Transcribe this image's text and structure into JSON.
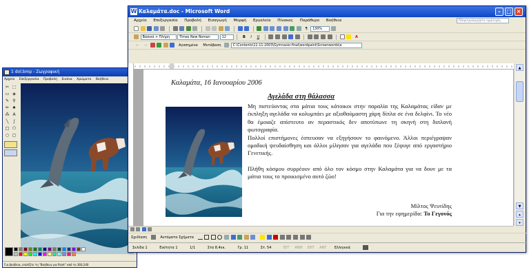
{
  "paint": {
    "title": "1 dol.bmp - Ζωγραφική",
    "menu": [
      "Αρχείο",
      "Επεξεργασία",
      "Προβολή",
      "Εικόνα",
      "Χρώματα",
      "Βοήθεια"
    ],
    "status": "Για βοήθεια, επιλέξτε τη \"Βοήθεια για Paint\" από το 360,240"
  },
  "word": {
    "title": "Καλαμάτα.doc - Microsoft Word",
    "menu": [
      "Αρχείο",
      "Επεξεργασία",
      "Προβολή",
      "Εισαγωγή",
      "Μορφή",
      "Εργαλεία",
      "Πίνακας",
      "Παράθυρο",
      "Βοήθεια"
    ],
    "help_placeholder": "Πληκτρολογήστε ερώτηση",
    "zoom": "130%",
    "style": "Βασικό + Πλήρη",
    "font": "Times New Roman",
    "size": "12",
    "web_back": "Αγαπημένα",
    "web_go": "Μετάβαση",
    "address": "C:\\Contents\\11-11-2003\\Gymnasio-final\\wordpaint\\Screenwords\\e",
    "drawing": "Σχεδίαση",
    "autoshapes": "Αυτόματα Σχήματα"
  },
  "document": {
    "date": "Καλαμάτα, 16 Ιανουαρίου 2006",
    "headline": "Αγελάδα στη θάλασσα",
    "para1": "Μη πιστεύοντας στα μάτια τους κάτοικοι στην παραλία της Καλαμάτας είδαν με έκπληξη αγελάδα να κολυμπάει με αξιοθαύμαστη χάρη δίπλα σε ένα δελφίνι. Το νέο θα έμοιαζε απίστευτο αν περαστικός δεν αποτύπωνε τη σκηνή στη διπλανή φωτογραφία.",
    "para2": "Πολλοί επιστήμονες έσπευσαν να εξηγήσουν το φαινόμενο. Άλλοι περιέγραψαν ομαδική ψευδαίσθηση και άλλοι μίλησαν για αγελάδα που ξέφυγε από εργαστήριο Γενετικής.",
    "para3": "Πλήθη κόσμου συρρέουν από όλο τον κόσμο στην Καλαμάτα για να δουν με τα μάτια τους το προικισμένο αυτό ζώο!",
    "author": "Μίλτος Ψευτίδης",
    "paper_prefix": "Για την εφημερίδα:",
    "paper_name": "Το Γεγονός"
  },
  "status_bar": {
    "section": "Σελίδα 1",
    "unit": "Ενότητα 1",
    "pages": "1/1",
    "at": "Στα 8,4εκ.",
    "line": "Γρ. 11",
    "col": "Στ. 54",
    "modes": [
      "ΕΓΓ",
      "ΑΝΘ",
      "ΕΚΤ",
      "ΑΝΤ"
    ],
    "lang": "Ελληνικά"
  },
  "colors": {
    "titlebar": "#0d47c4",
    "sea": "#1f6f96",
    "sky": "#0d2e6e"
  }
}
